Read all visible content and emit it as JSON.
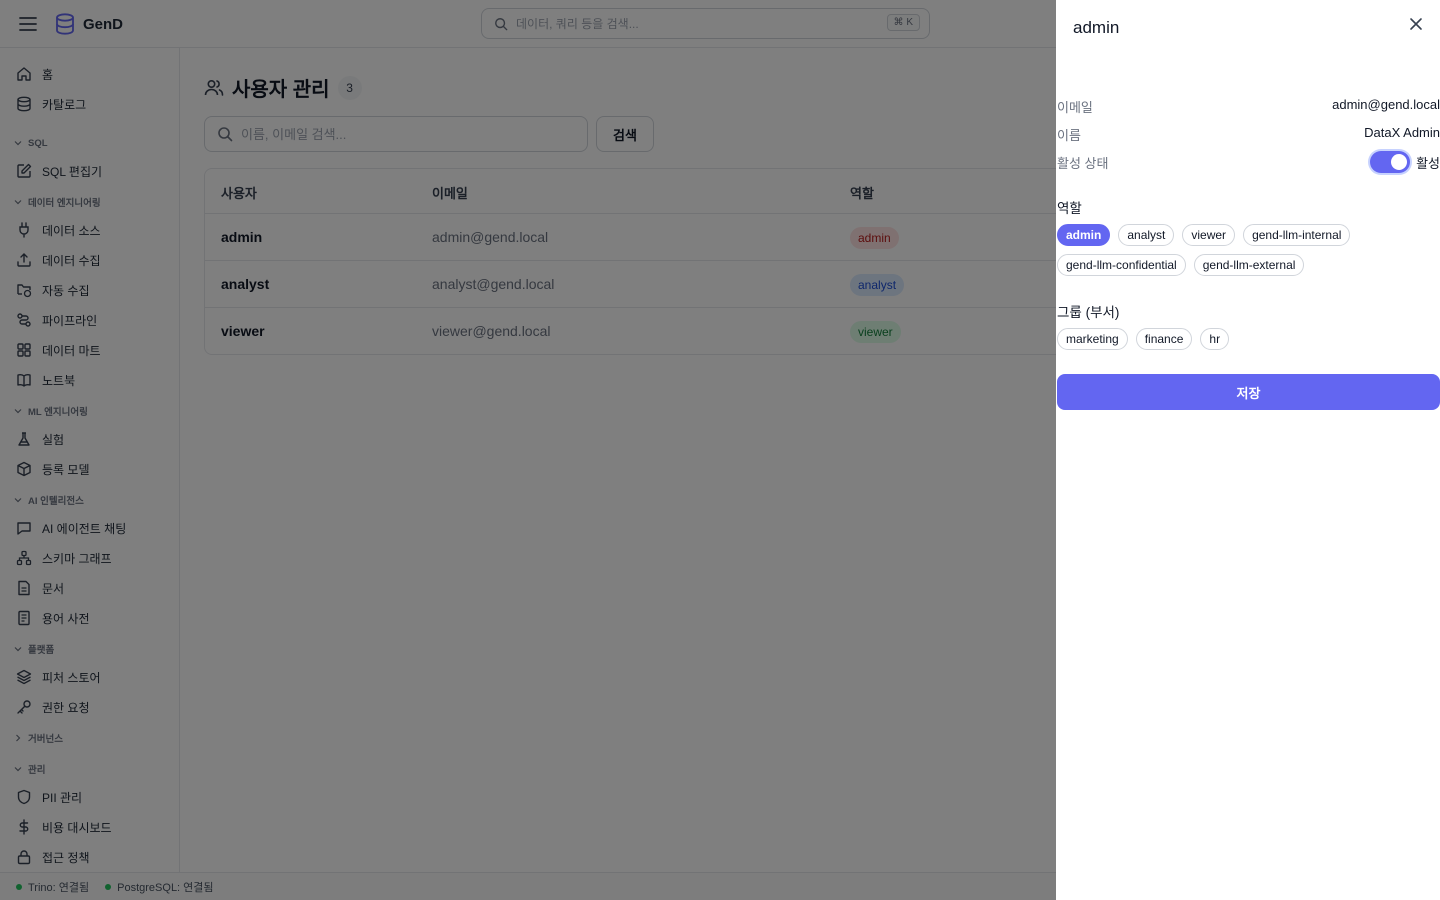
{
  "app": {
    "name": "GenD"
  },
  "header": {
    "search_placeholder": "데이터, 쿼리 등을 검색...",
    "shortcut": "⌘ K"
  },
  "sidebar": {
    "top_items": [
      {
        "label": "홈",
        "icon": "home-icon"
      },
      {
        "label": "카탈로그",
        "icon": "database-icon"
      }
    ],
    "sections": [
      {
        "title": "SQL",
        "expanded": true,
        "items": [
          {
            "label": "SQL 편집기",
            "icon": "edit-icon"
          }
        ]
      },
      {
        "title": "데이터 엔지니어링",
        "expanded": true,
        "items": [
          {
            "label": "데이터 소스",
            "icon": "plug-icon"
          },
          {
            "label": "데이터 수집",
            "icon": "upload-icon"
          },
          {
            "label": "자동 수집",
            "icon": "folder-sync-icon"
          },
          {
            "label": "파이프라인",
            "icon": "route-icon"
          },
          {
            "label": "데이터 마트",
            "icon": "grid-icon"
          },
          {
            "label": "노트북",
            "icon": "book-icon"
          }
        ]
      },
      {
        "title": "ML 엔지니어링",
        "expanded": true,
        "items": [
          {
            "label": "실험",
            "icon": "flask-icon"
          },
          {
            "label": "등록 모델",
            "icon": "box-icon"
          }
        ]
      },
      {
        "title": "AI 인텔리전스",
        "expanded": true,
        "items": [
          {
            "label": "AI 에이전트 채팅",
            "icon": "chat-icon"
          },
          {
            "label": "스키마 그래프",
            "icon": "network-icon"
          },
          {
            "label": "문서",
            "icon": "document-icon"
          },
          {
            "label": "용어 사전",
            "icon": "dictionary-icon"
          }
        ]
      },
      {
        "title": "플랫폼",
        "expanded": true,
        "items": [
          {
            "label": "피처 스토어",
            "icon": "layers-icon"
          },
          {
            "label": "권한 요청",
            "icon": "key-icon"
          }
        ]
      },
      {
        "title": "거버넌스",
        "expanded": false,
        "items": []
      },
      {
        "title": "관리",
        "expanded": true,
        "items": [
          {
            "label": "PII 관리",
            "icon": "shield-icon"
          },
          {
            "label": "비용 대시보드",
            "icon": "dollar-icon"
          },
          {
            "label": "접근 정책",
            "icon": "lock-icon"
          }
        ]
      }
    ]
  },
  "status": [
    {
      "label": "Trino: 연결됨",
      "color": "#22c55e"
    },
    {
      "label": "PostgreSQL: 연결됨",
      "color": "#22c55e"
    }
  ],
  "main": {
    "title": "사용자 관리",
    "count": "3",
    "search_placeholder": "이름, 이메일 검색...",
    "search_button": "검색",
    "columns": [
      "사용자",
      "이메일",
      "역할"
    ],
    "rows": [
      {
        "user": "admin",
        "email": "admin@gend.local",
        "role": "admin",
        "role_bg": "#fee2e2",
        "role_color": "#b91c1c"
      },
      {
        "user": "analyst",
        "email": "analyst@gend.local",
        "role": "analyst",
        "role_bg": "#dbeafe",
        "role_color": "#1d4ed8"
      },
      {
        "user": "viewer",
        "email": "viewer@gend.local",
        "role": "viewer",
        "role_bg": "#dcfce7",
        "role_color": "#15803d"
      }
    ]
  },
  "drawer": {
    "title": "admin",
    "fields": {
      "email_label": "이메일",
      "email_value": "admin@gend.local",
      "name_label": "이름",
      "name_value": "DataX Admin",
      "status_label": "활성 상태",
      "status_value": "활성",
      "status_on": true
    },
    "roles_title": "역할",
    "roles": [
      {
        "label": "admin",
        "selected": true
      },
      {
        "label": "analyst",
        "selected": false
      },
      {
        "label": "viewer",
        "selected": false
      },
      {
        "label": "gend-llm-internal",
        "selected": false
      },
      {
        "label": "gend-llm-confidential",
        "selected": false
      },
      {
        "label": "gend-llm-external",
        "selected": false
      }
    ],
    "groups_title": "그룹 (부서)",
    "groups": [
      {
        "label": "marketing",
        "selected": false
      },
      {
        "label": "finance",
        "selected": false
      },
      {
        "label": "hr",
        "selected": false
      }
    ],
    "save_label": "저장"
  },
  "colors": {
    "accent": "#6366f1",
    "overlay": "rgba(0,0,0,0.5)"
  }
}
